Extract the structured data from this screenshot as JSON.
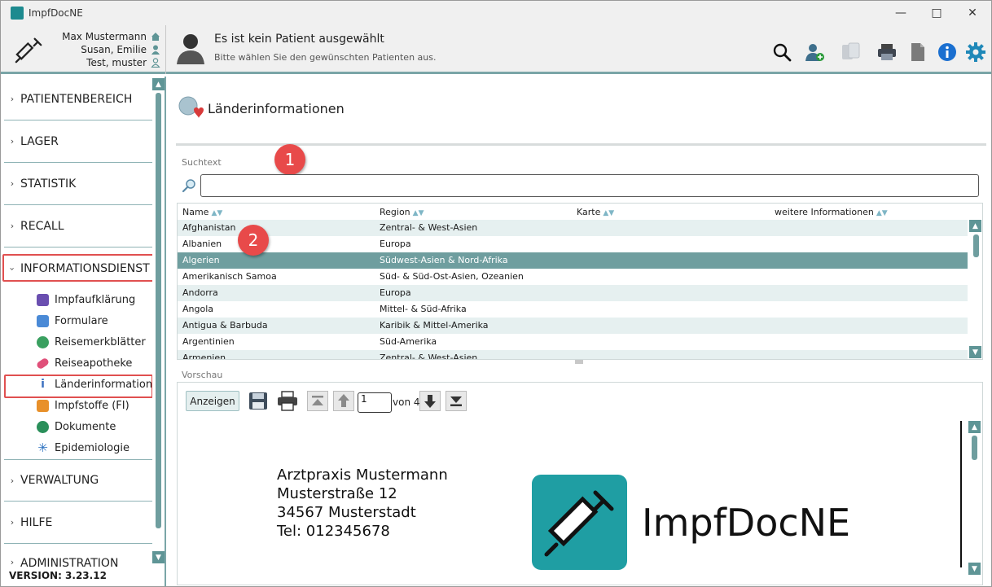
{
  "window": {
    "title": "ImpfDocNE"
  },
  "header": {
    "users": [
      {
        "name": "Max Mustermann"
      },
      {
        "name": "Susan, Emilie"
      },
      {
        "name": "Test, muster"
      }
    ],
    "patient_title": "Es ist kein Patient ausgewählt",
    "patient_sub": "Bitte wählen Sie den gewünschten Patienten aus."
  },
  "sidebar": {
    "sections": [
      {
        "label": "PATIENTENBEREICH"
      },
      {
        "label": "LAGER"
      },
      {
        "label": "STATISTIK"
      },
      {
        "label": "RECALL"
      },
      {
        "label": "INFORMATIONSDIENST"
      },
      {
        "label": "VERWALTUNG"
      },
      {
        "label": "HILFE"
      },
      {
        "label": "ADMINISTRATION"
      }
    ],
    "info_items": [
      {
        "label": "Impfaufklärung",
        "color": "#6a4fb0"
      },
      {
        "label": "Formulare",
        "color": "#4a8ad6"
      },
      {
        "label": "Reisemerkblätter",
        "color": "#3aa060"
      },
      {
        "label": "Reiseapotheke",
        "color": "#e0507a"
      },
      {
        "label": "Länderinformation",
        "color": "#3a6fc0"
      },
      {
        "label": "Impfstoffe (FI)",
        "color": "#e8902a"
      },
      {
        "label": "Dokumente",
        "color": "#2a8f5a"
      },
      {
        "label": "Epidemiologie",
        "color": "#2a70c0"
      }
    ],
    "version": "VERSION: 3.23.12"
  },
  "main": {
    "title": "Länderinformationen",
    "search_label": "Suchtext",
    "search_value": "",
    "badges": [
      "1",
      "2"
    ],
    "columns": [
      "Name",
      "Region",
      "Karte",
      "weitere Informationen"
    ],
    "rows": [
      {
        "name": "Afghanistan",
        "region": "Zentral- & West-Asien"
      },
      {
        "name": "Albanien",
        "region": "Europa"
      },
      {
        "name": "Algerien",
        "region": "Südwest-Asien & Nord-Afrika"
      },
      {
        "name": "Amerikanisch Samoa",
        "region": "Süd- & Süd-Ost-Asien, Ozeanien"
      },
      {
        "name": "Andorra",
        "region": "Europa"
      },
      {
        "name": "Angola",
        "region": "Mittel- & Süd-Afrika"
      },
      {
        "name": "Antigua & Barbuda",
        "region": "Karibik & Mittel-Amerika"
      },
      {
        "name": "Argentinien",
        "region": "Süd-Amerika"
      },
      {
        "name": "Armenien",
        "region": "Zentral- & West-Asien"
      }
    ],
    "selected_row": "Algerien"
  },
  "preview": {
    "label": "Vorschau",
    "show_button": "Anzeigen",
    "page": "1",
    "of_pages": "von 4",
    "doc_lines": [
      "Arztpraxis Mustermann",
      "Musterstraße 12",
      "34567 Musterstadt",
      "Tel: 012345678"
    ],
    "logo_text": "ImpfDocNE"
  },
  "colors": {
    "accent": "#6f9e9f",
    "highlight_box": "#e05050",
    "badge": "#e84a4a",
    "logo": "#1f9ea3"
  }
}
